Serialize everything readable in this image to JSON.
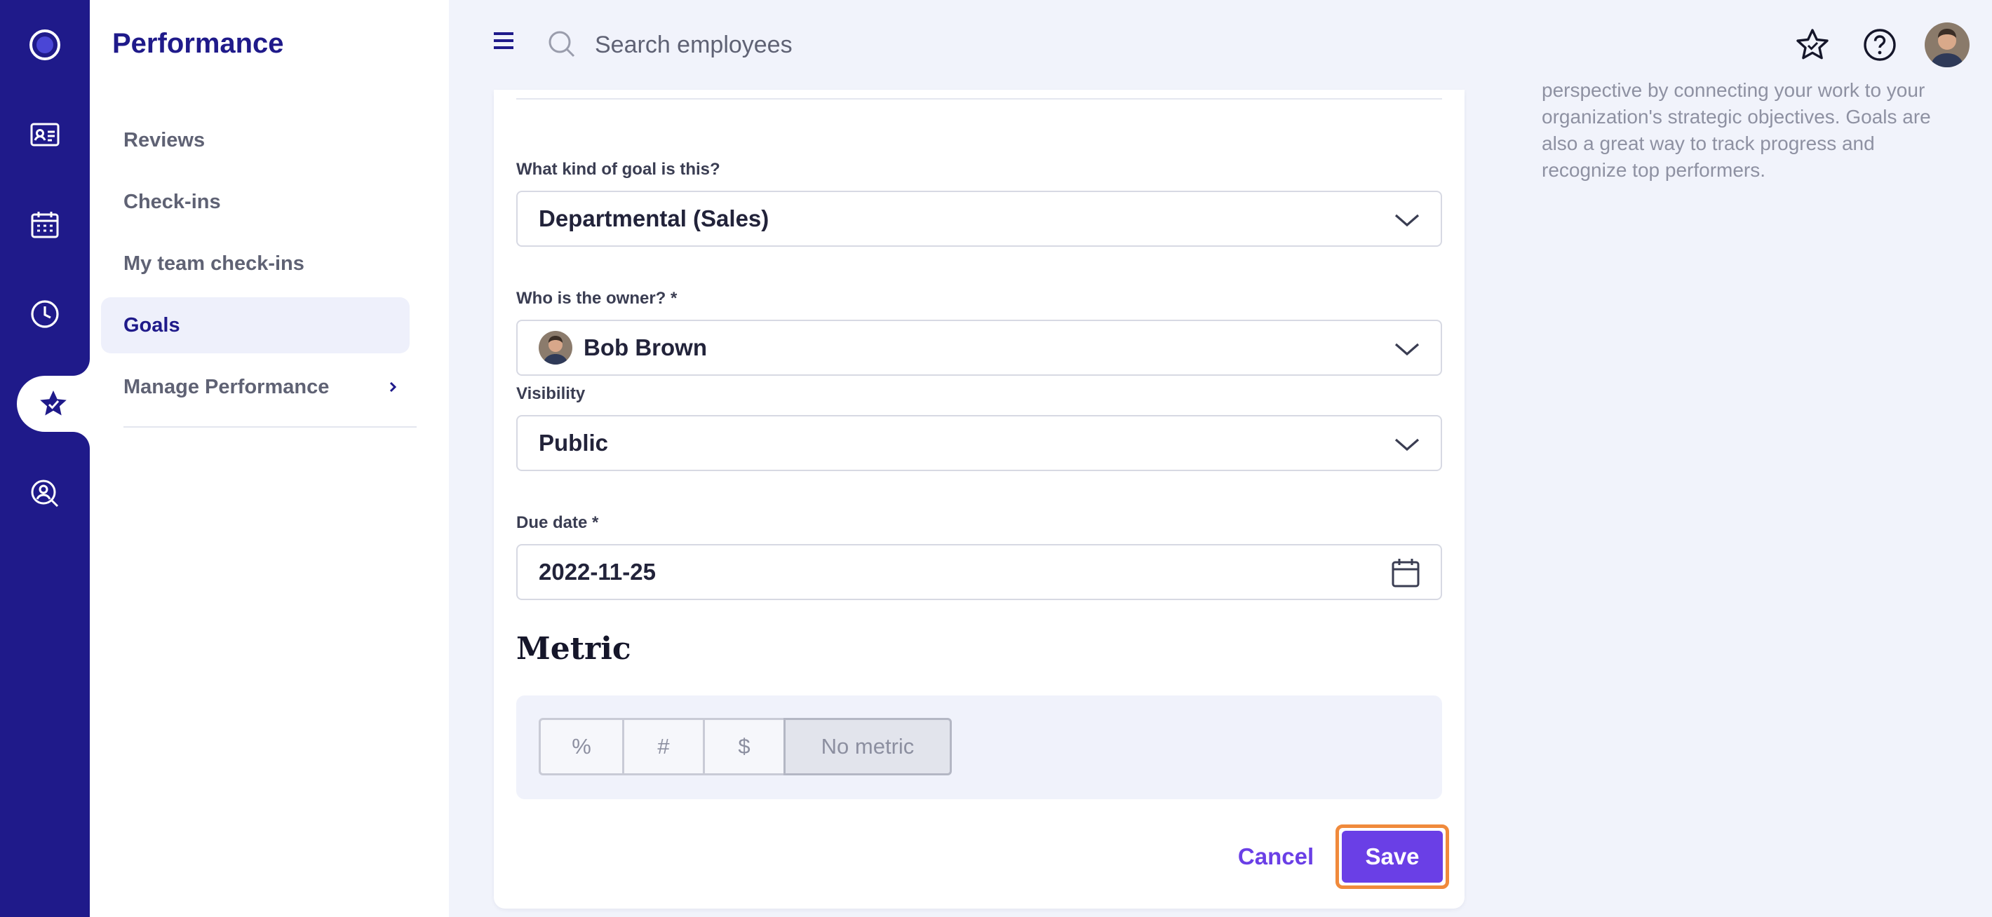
{
  "sidebar": {
    "title": "Performance",
    "items": [
      {
        "label": "Reviews"
      },
      {
        "label": "Check-ins"
      },
      {
        "label": "My team check-ins"
      },
      {
        "label": "Goals"
      },
      {
        "label": "Manage Performance"
      }
    ]
  },
  "topbar": {
    "search_placeholder": "Search employees"
  },
  "form": {
    "goal_kind": {
      "label": "What kind of goal is this?",
      "value": "Departmental (Sales)"
    },
    "owner": {
      "label": "Who is the owner? *",
      "value": "Bob Brown"
    },
    "visibility": {
      "label": "Visibility",
      "value": "Public"
    },
    "due_date": {
      "label": "Due date *",
      "value": "2022-11-25"
    },
    "metric": {
      "title": "Metric",
      "options": [
        "%",
        "#",
        "$",
        "No metric"
      ],
      "selected": "No metric"
    },
    "cancel_label": "Cancel",
    "save_label": "Save"
  },
  "help": {
    "line1": "perspective by connecting your work to your",
    "line2": "organization's strategic objectives. Goals are",
    "line3": "also a great way to track progress and",
    "line4": "recognize top performers."
  },
  "colors": {
    "rail": "#1f1a8a",
    "accent": "#6a3fe6",
    "save_focus_outline": "#f08a3c"
  },
  "icons": {
    "rail": [
      "logo-icon",
      "id-card-icon",
      "calendar-icon",
      "clock-icon",
      "performance-star-icon",
      "search-person-icon"
    ],
    "topbar": [
      "menu-icon",
      "search-icon",
      "star-icon",
      "help-icon",
      "user-avatar"
    ]
  }
}
